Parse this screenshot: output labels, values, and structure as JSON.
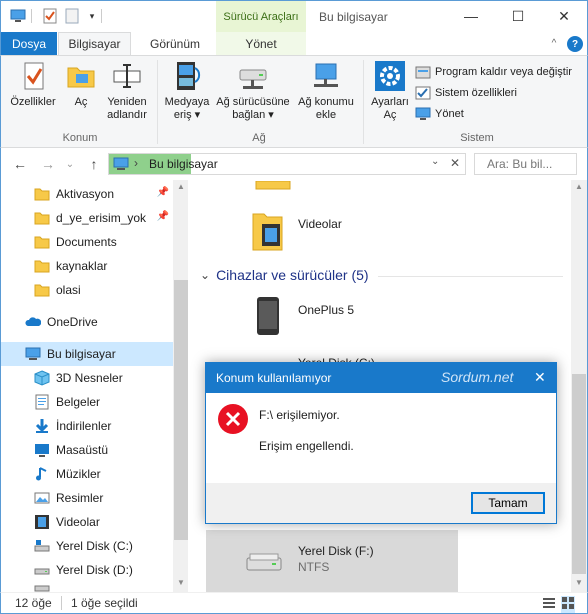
{
  "titlebar": {
    "context_tab_group": "Sürücü Araçları",
    "window_title": "Bu bilgisayar",
    "minimize_glyph": "—",
    "maximize_glyph": "☐",
    "close_glyph": "✕"
  },
  "tabs": {
    "file": "Dosya",
    "computer": "Bilgisayar",
    "view": "Görünüm",
    "manage": "Yönet",
    "collapse_glyph": "^",
    "help_glyph": "?"
  },
  "ribbon": {
    "properties": "Özellikler",
    "open": "Aç",
    "rename_1": "Yeniden",
    "rename_2": "adlandır",
    "group_location": "Konum",
    "media_1": "Medyaya",
    "media_2": "eriş ▾",
    "map_drive_1": "Ağ sürücüsüne",
    "map_drive_2": "bağlan ▾",
    "add_location_1": "Ağ konumu",
    "add_location_2": "ekle",
    "group_network": "Ağ",
    "settings_1": "Ayarları",
    "settings_2": "Aç",
    "uninstall": "Program kaldır veya değiştir",
    "system_props": "Sistem özellikleri",
    "manage": "Yönet",
    "group_system": "Sistem"
  },
  "address": {
    "back": "←",
    "forward": "→",
    "recent": "⌄",
    "up": "↑",
    "chevron": "›",
    "path": "Bu bilgisayar",
    "dropdown": "⌄",
    "clear": "✕",
    "search_placeholder": "Ara: Bu bil..."
  },
  "nav": {
    "quick_access": [
      "Aktivasyon",
      "d_ye_erisim_yok",
      "Documents",
      "kaynaklar",
      "olasi"
    ],
    "onedrive": "OneDrive",
    "this_pc": "Bu bilgisayar",
    "pc_items": [
      "3D Nesneler",
      "Belgeler",
      "İndirilenler",
      "Masaüstü",
      "Müzikler",
      "Resimler",
      "Videolar",
      "Yerel Disk (C:)",
      "Yerel Disk (D:)"
    ]
  },
  "content": {
    "videos": "Videolar",
    "devices_header": "Cihazlar ve sürücüler (5)",
    "oneplus": "OnePlus 5",
    "partial_item": "Yerel Disk (C:)",
    "disk_f": "Yerel Disk (F:)",
    "disk_f_fs": "NTFS"
  },
  "status": {
    "count": "12 öğe",
    "selected": "1 öğe seçildi"
  },
  "dialog": {
    "title": "Konum kullanılamıyor",
    "watermark": "Sordum.net",
    "close_glyph": "✕",
    "line1": "F:\\ erişilemiyor.",
    "line2": "Erişim engellendi.",
    "ok": "Tamam"
  },
  "colors": {
    "accent": "#1979ca",
    "context_tab": "#e8f5d4",
    "selection": "#cce8ff",
    "error_red": "#e81123"
  }
}
